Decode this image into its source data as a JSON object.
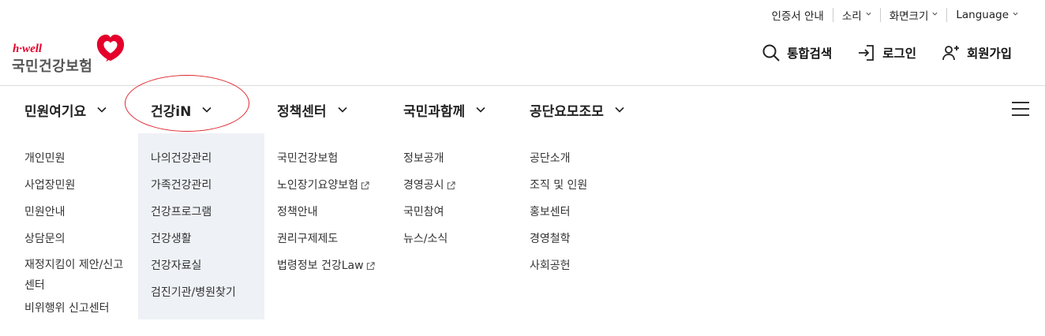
{
  "utility": [
    {
      "label": "인증서 안내",
      "has_chevron": false
    },
    {
      "label": "소리",
      "has_chevron": true
    },
    {
      "label": "화면크기",
      "has_chevron": true
    },
    {
      "label": "Language",
      "has_chevron": true
    }
  ],
  "logo": {
    "brand": "h·well",
    "name": "국민건강보험",
    "icon": "heart-logo-icon",
    "color": "#e5002b"
  },
  "actions": [
    {
      "label": "통합검색",
      "icon": "search-icon"
    },
    {
      "label": "로그인",
      "icon": "login-icon"
    },
    {
      "label": "회원가입",
      "icon": "user-plus-icon"
    }
  ],
  "nav": [
    {
      "label": "민원여기요"
    },
    {
      "label": "건강iN",
      "active": true
    },
    {
      "label": "정책센터"
    },
    {
      "label": "국민과함께"
    },
    {
      "label": "공단요모조모"
    }
  ],
  "menu_icon": "hamburger-icon",
  "annotation_color": "#e0262e",
  "columns": [
    {
      "items": [
        {
          "label": "개인민원"
        },
        {
          "label": "사업장민원"
        },
        {
          "label": "민원안내"
        },
        {
          "label": "상담문의"
        },
        {
          "label": "재정지킴이 제안/신고센터"
        },
        {
          "label": "비위행위 신고센터"
        }
      ]
    },
    {
      "items": [
        {
          "label": "나의건강관리"
        },
        {
          "label": "가족건강관리"
        },
        {
          "label": "건강프로그램"
        },
        {
          "label": "건강생활"
        },
        {
          "label": "건강자료실"
        },
        {
          "label": "검진기관/병원찾기"
        }
      ]
    },
    {
      "items": [
        {
          "label": "국민건강보험"
        },
        {
          "label": "노인장기요양보험",
          "external": true
        },
        {
          "label": "정책안내"
        },
        {
          "label": "권리구제제도"
        },
        {
          "label": "법령정보 건강Law",
          "external": true
        }
      ]
    },
    {
      "items": [
        {
          "label": "정보공개"
        },
        {
          "label": "경영공시",
          "external": true
        },
        {
          "label": "국민참여"
        },
        {
          "label": "뉴스/소식"
        }
      ]
    },
    {
      "items": [
        {
          "label": "공단소개"
        },
        {
          "label": "조직 및 인원"
        },
        {
          "label": "홍보센터"
        },
        {
          "label": "경영철학"
        },
        {
          "label": "사회공헌"
        }
      ]
    }
  ]
}
